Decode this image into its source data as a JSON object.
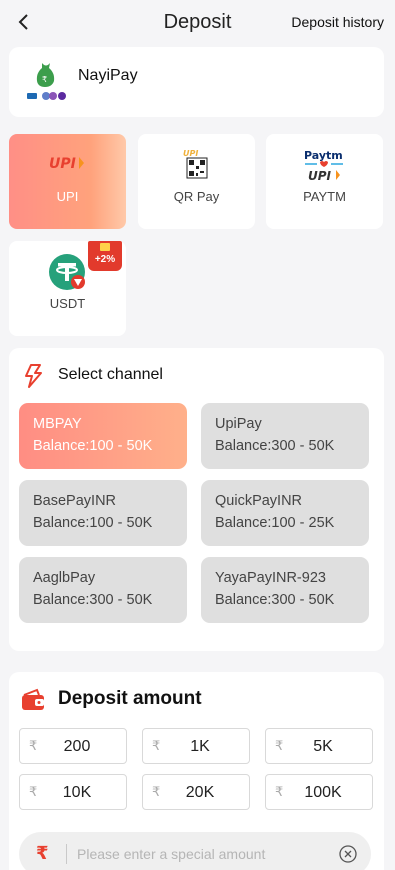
{
  "header": {
    "title": "Deposit",
    "history_label": "Deposit history"
  },
  "provider": {
    "name": "NayiPay"
  },
  "methods": [
    {
      "label": "UPI",
      "active": true
    },
    {
      "label": "QR Pay"
    },
    {
      "label": "PAYTM"
    },
    {
      "label": "USDT",
      "badge": "+2%"
    }
  ],
  "icons": {
    "upi_logo": "UPI",
    "paytm_top": "Paytm",
    "paytm_bottom": "UPI",
    "qr_upi": "UPI"
  },
  "channel": {
    "title": "Select channel",
    "items": [
      {
        "name": "MBPAY",
        "balance": "Balance:100 - 50K",
        "active": true
      },
      {
        "name": "UpiPay",
        "balance": "Balance:300 - 50K"
      },
      {
        "name": "BasePayINR",
        "balance": "Balance:100 - 50K"
      },
      {
        "name": "QuickPayINR",
        "balance": "Balance:100 - 25K"
      },
      {
        "name": "AaglbPay",
        "balance": "Balance:300 - 50K"
      },
      {
        "name": "YayaPayINR-923",
        "balance": "Balance:300 - 50K"
      }
    ]
  },
  "amount": {
    "title": "Deposit amount",
    "currency": "₹",
    "options": [
      "200",
      "1K",
      "5K",
      "10K",
      "20K",
      "100K"
    ],
    "placeholder": "Please enter a special amount"
  },
  "colors": {
    "accent": "#ff8f86",
    "rupee": "#e8402f",
    "badge": "#e23a2c",
    "usdt": "#26a17b"
  }
}
